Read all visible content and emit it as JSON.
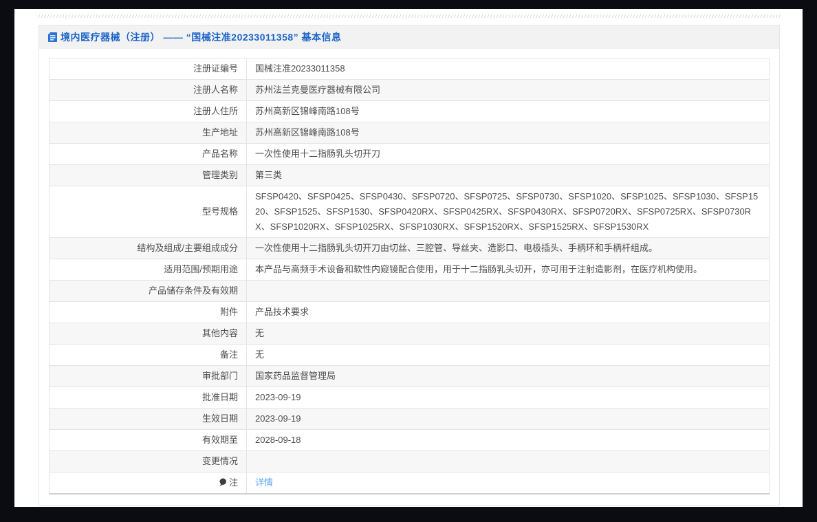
{
  "colors": {
    "frame": "#0a0c12",
    "title_blue": "#1c64c8",
    "link_blue": "#5aa4ef",
    "zebra_gray": "#f7f7f7",
    "title_bar_gray": "#f2f2f2"
  },
  "header": {
    "icon": "document-icon",
    "title": "境内医疗器械（注册） —— “国械注准20233011358” 基本信息"
  },
  "table": {
    "rows": [
      {
        "label": "注册证编号",
        "value": "国械注准20233011358"
      },
      {
        "label": "注册人名称",
        "value": "苏州法兰克曼医疗器械有限公司"
      },
      {
        "label": "注册人住所",
        "value": "苏州高新区锦峰南路108号"
      },
      {
        "label": "生产地址",
        "value": "苏州高新区锦峰南路108号"
      },
      {
        "label": "产品名称",
        "value": "一次性使用十二指肠乳头切开刀"
      },
      {
        "label": "管理类别",
        "value": "第三类"
      },
      {
        "label": "型号规格",
        "value": "SFSP0420、SFSP0425、SFSP0430、SFSP0720、SFSP0725、SFSP0730、SFSP1020、SFSP1025、SFSP1030、SFSP1520、SFSP1525、SFSP1530、SFSP0420RX、SFSP0425RX、SFSP0430RX、SFSP0720RX、SFSP0725RX、SFSP0730RX、SFSP1020RX、SFSP1025RX、SFSP1030RX、SFSP1520RX、SFSP1525RX、SFSP1530RX"
      },
      {
        "label": "结构及组成/主要组成成分",
        "value": "一次性使用十二指肠乳头切开刀由切丝、三腔管、导丝夹、造影口、电极插头、手柄环和手柄杆组成。"
      },
      {
        "label": "适用范围/预期用途",
        "value": "本产品与高频手术设备和软性内窥镜配合使用，用于十二指肠乳头切开，亦可用于注射造影剂，在医疗机构使用。"
      },
      {
        "label": "产品储存条件及有效期",
        "value": ""
      },
      {
        "label": "附件",
        "value": "产品技术要求"
      },
      {
        "label": "其他内容",
        "value": "无"
      },
      {
        "label": "备注",
        "value": "无"
      },
      {
        "label": "审批部门",
        "value": "国家药品监督管理局"
      },
      {
        "label": "批准日期",
        "value": "2023-09-19"
      },
      {
        "label": "生效日期",
        "value": "2023-09-19"
      },
      {
        "label": "有效期至",
        "value": "2028-09-18"
      },
      {
        "label": "变更情况",
        "value": ""
      },
      {
        "label": "注",
        "label_icon": "note-icon",
        "value": "详情",
        "value_is_link": true
      }
    ]
  }
}
